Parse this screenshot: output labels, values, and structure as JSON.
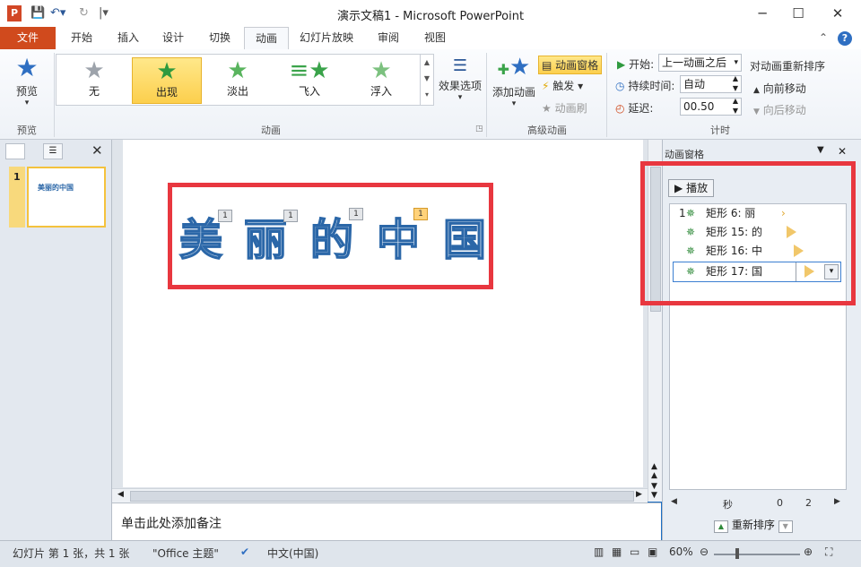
{
  "window": {
    "title": "演示文稿1 - Microsoft PowerPoint",
    "minimize": "─",
    "maximize": "☐",
    "close": "✕"
  },
  "tabs": [
    "文件",
    "开始",
    "插入",
    "设计",
    "切换",
    "动画",
    "幻灯片放映",
    "审阅",
    "视图"
  ],
  "ribbon": {
    "preview": {
      "label": "预览",
      "group": "预览"
    },
    "gallery": {
      "items": [
        "无",
        "出现",
        "淡出",
        "飞入",
        "浮入"
      ],
      "selected": 1,
      "effect_options": "效果选项",
      "group": "动画"
    },
    "advanced": {
      "add_animation": "添加动画",
      "animation_pane": "动画窗格",
      "trigger": "触发",
      "animation_painter": "动画刷",
      "group": "高级动画"
    },
    "timing": {
      "start_label": "开始:",
      "start_value": "上一动画之后",
      "duration_label": "持续时间:",
      "duration_value": "自动",
      "delay_label": "延迟:",
      "delay_value": "00.50",
      "reorder_title": "对动画重新排序",
      "move_earlier": "向前移动",
      "move_later": "向后移动",
      "group": "计时"
    }
  },
  "slides_panel": {
    "slide_number": "1",
    "thumb_text": "美丽的中国"
  },
  "slide": {
    "words": [
      "美",
      "丽",
      "的",
      "中",
      "国"
    ],
    "badges": [
      "1",
      "1",
      "1",
      "1"
    ]
  },
  "notes_placeholder": "单击此处添加备注",
  "anim_pane": {
    "title": "动画窗格",
    "play": "播放",
    "items": [
      {
        "index": "1",
        "label": "矩形 6: 丽"
      },
      {
        "index": "",
        "label": "矩形 15: 的"
      },
      {
        "index": "",
        "label": "矩形 16: 中"
      },
      {
        "index": "",
        "label": "矩形 17: 国"
      }
    ],
    "seconds_label": "秒",
    "tick_0": "0",
    "tick_2": "2",
    "reorder": "重新排序"
  },
  "status": {
    "slide_info": "幻灯片 第 1 张，共 1 张",
    "theme": "\"Office 主题\"",
    "language": "中文(中国)",
    "zoom": "60%"
  },
  "colors": {
    "file_tab": "#d04a1d",
    "highlight_box": "#e8373f",
    "word_outline": "#2b67a8"
  }
}
